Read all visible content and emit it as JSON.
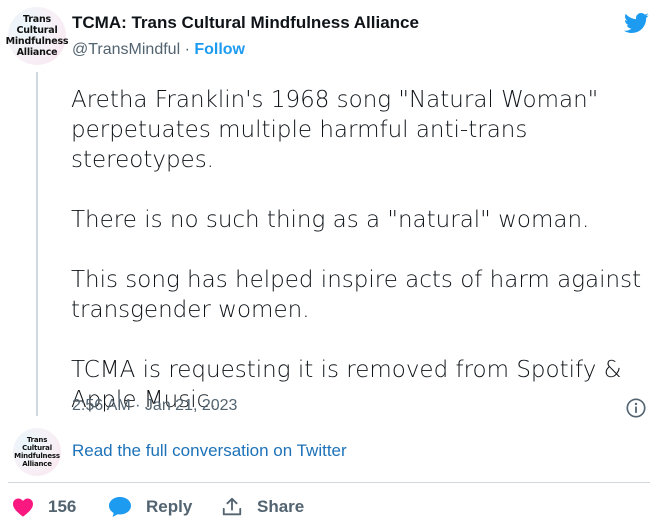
{
  "account": {
    "display_name": "TCMA: Trans Cultural Mindfulness Alliance",
    "handle": "@TransMindful",
    "separator": " · ",
    "follow_label": "Follow",
    "avatar_text": "Trans\nCultural\nMindfulness\nAlliance"
  },
  "tweet": {
    "paragraphs": [
      "Aretha Franklin's 1968 song \"Natural Woman\" perpetuates multiple harmful anti-trans stereotypes.",
      "There is no such thing as a \"natural\" woman.",
      "This song has helped inspire acts of harm against transgender women.",
      "TCMA is requesting it is removed from Spotify & Apple Music."
    ],
    "timestamp": "2:56 AM · Jan 21, 2023"
  },
  "conversation": {
    "link_label": "Read the full conversation on Twitter"
  },
  "actions": {
    "like_count": "156",
    "reply_label": "Reply",
    "share_label": "Share"
  },
  "icons": {
    "brand": "twitter-bird-icon",
    "info": "info-icon",
    "like": "heart-icon",
    "reply": "speech-bubble-icon",
    "share": "share-icon"
  },
  "colors": {
    "brand_blue": "#1d9bf0",
    "link_blue": "#1d72b8",
    "like_red": "#f91880",
    "secondary_text": "#536471",
    "primary_text": "#0f1419",
    "divider": "#cfd9de"
  }
}
